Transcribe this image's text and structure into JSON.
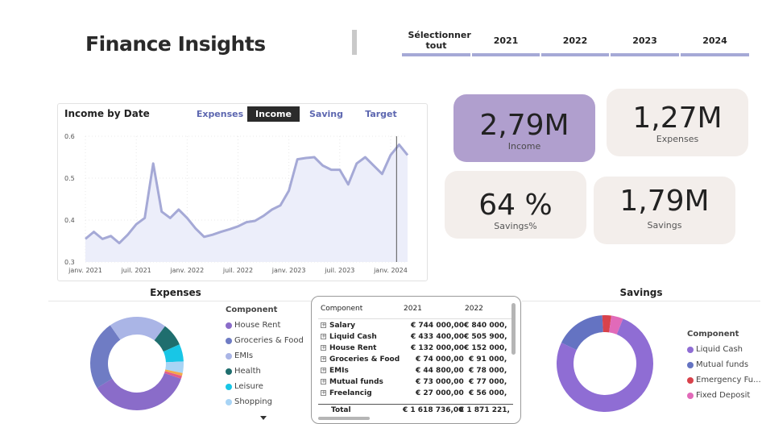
{
  "header": {
    "title": "Finance Insights"
  },
  "year_slicer": {
    "items": [
      {
        "label": "Sélectionner tout"
      },
      {
        "label": "2021"
      },
      {
        "label": "2022"
      },
      {
        "label": "2023"
      },
      {
        "label": "2024"
      }
    ]
  },
  "kpis": {
    "income": {
      "value": "2,79M",
      "label": "Income"
    },
    "expenses": {
      "value": "1,27M",
      "label": "Expenses"
    },
    "savings_pct": {
      "value": "64 %",
      "label": "Savings%"
    },
    "savings": {
      "value": "1,79M",
      "label": "Savings"
    }
  },
  "colors": {
    "accent_purple": "#b09fce",
    "kpi_bg": "#f3eeeb",
    "line": "#a5a9d6",
    "slicer_underline": "#a5a9d6"
  },
  "income_chart": {
    "title": "Income by Date",
    "tabs": [
      {
        "label": "Expenses",
        "active": false
      },
      {
        "label": "Income",
        "active": true
      },
      {
        "label": "Saving",
        "active": false
      },
      {
        "label": "Target",
        "active": false
      }
    ],
    "x_tick_labels": [
      "janv. 2021",
      "juil. 2021",
      "janv. 2022",
      "juil. 2022",
      "janv. 2023",
      "juil. 2023",
      "janv. 2024"
    ],
    "y_tick_labels": [
      "0.6",
      "0.5",
      "0.4",
      "0.3"
    ]
  },
  "chart_data": {
    "type": "area",
    "title": "Income by Date",
    "xlabel": "",
    "ylabel": "",
    "ylim": [
      0.3,
      0.6
    ],
    "x": [
      "2021-01",
      "2021-02",
      "2021-03",
      "2021-04",
      "2021-05",
      "2021-06",
      "2021-07",
      "2021-08",
      "2021-09",
      "2021-10",
      "2021-11",
      "2021-12",
      "2022-01",
      "2022-02",
      "2022-03",
      "2022-04",
      "2022-05",
      "2022-06",
      "2022-07",
      "2022-08",
      "2022-09",
      "2022-10",
      "2022-11",
      "2022-12",
      "2023-01",
      "2023-02",
      "2023-03",
      "2023-04",
      "2023-05",
      "2023-06",
      "2023-07",
      "2023-08",
      "2023-09",
      "2023-10",
      "2023-11",
      "2023-12",
      "2024-01",
      "2024-02",
      "2024-03"
    ],
    "values": [
      0.355,
      0.372,
      0.355,
      0.362,
      0.345,
      0.365,
      0.39,
      0.405,
      0.535,
      0.42,
      0.405,
      0.425,
      0.405,
      0.38,
      0.36,
      0.365,
      0.372,
      0.378,
      0.385,
      0.395,
      0.398,
      0.41,
      0.425,
      0.435,
      0.47,
      0.545,
      0.548,
      0.55,
      0.53,
      0.52,
      0.52,
      0.485,
      0.535,
      0.55,
      0.53,
      0.51,
      0.555,
      0.58,
      0.555
    ],
    "grid": true,
    "marker_date": "2024-01"
  },
  "expenses_donut": {
    "title": "Expenses",
    "legend_title": "Component",
    "items": [
      {
        "label": "House Rent",
        "color": "#8a6cc9",
        "value": 36
      },
      {
        "label": "Groceries & Food",
        "color": "#6f7cc4",
        "value": 24
      },
      {
        "label": "EMIs",
        "color": "#aab5e6",
        "value": 20
      },
      {
        "label": "Health",
        "color": "#1f6e6e",
        "value": 8
      },
      {
        "label": "Leisure",
        "color": "#18c6e6",
        "value": 6
      },
      {
        "label": "Shopping",
        "color": "#a8d4f5",
        "value": 4
      },
      {
        "label": "",
        "color": "#f3a94b",
        "value": 1
      },
      {
        "label": "",
        "color": "#e25c8a",
        "value": 1
      }
    ]
  },
  "savings_donut": {
    "title": "Savings",
    "legend_title": "Component",
    "items": [
      {
        "label": "Liquid Cash",
        "color": "#8f6dd4",
        "value": 76
      },
      {
        "label": "Mutual funds",
        "color": "#6473c2",
        "value": 17
      },
      {
        "label": "Emergency Fu...",
        "color": "#d8424b",
        "value": 3
      },
      {
        "label": "Fixed Deposit",
        "color": "#e16ab9",
        "value": 4
      }
    ]
  },
  "matrix": {
    "headers": [
      "Component",
      "2021",
      "2022"
    ],
    "rows": [
      {
        "name": "Salary",
        "y2021": "€ 744 000,00",
        "y2022": "€ 840 000,"
      },
      {
        "name": "Liquid Cash",
        "y2021": "€ 433 400,00",
        "y2022": "€ 505 900,"
      },
      {
        "name": "House Rent",
        "y2021": "€ 132 000,00",
        "y2022": "€ 152 000,"
      },
      {
        "name": "Groceries & Food",
        "y2021": "€ 74 000,00",
        "y2022": "€ 91 000,"
      },
      {
        "name": "EMIs",
        "y2021": "€ 44 800,00",
        "y2022": "€ 78 000,"
      },
      {
        "name": "Mutual funds",
        "y2021": "€ 73 000,00",
        "y2022": "€ 77 000,"
      },
      {
        "name": "Freelancig",
        "y2021": "€ 27 000,00",
        "y2022": "€ 56 000,"
      }
    ],
    "total": {
      "name": "Total",
      "y2021": "€ 1 618 736,00",
      "y2022": "€ 1 871 221,"
    }
  }
}
